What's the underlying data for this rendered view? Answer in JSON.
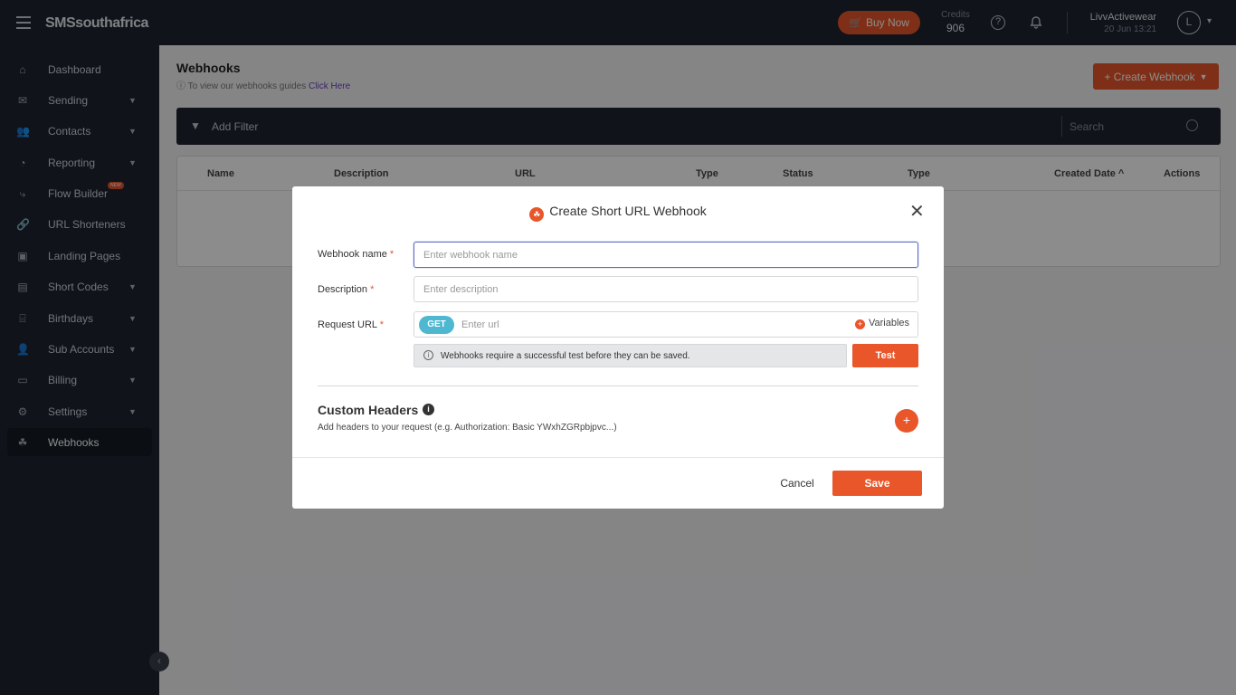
{
  "topbar": {
    "logo": "SMSsouthafrica",
    "buy_now": "Buy Now",
    "credits_label": "Credits",
    "credits_value": "906",
    "user_name": "LivvActivewear",
    "user_date": "20 Jun 13:21",
    "avatar_initial": "L"
  },
  "sidebar": {
    "items": [
      {
        "label": "Dashboard",
        "icon": "home-icon"
      },
      {
        "label": "Sending",
        "icon": "mail-icon"
      },
      {
        "label": "Contacts",
        "icon": "users-icon"
      },
      {
        "label": "Reporting",
        "icon": "chart-icon"
      },
      {
        "label": "Flow Builder",
        "icon": "flow-icon",
        "badge": "NEW"
      },
      {
        "label": "URL Shorteners",
        "icon": "link-icon"
      },
      {
        "label": "Landing Pages",
        "icon": "page-icon"
      },
      {
        "label": "Short Codes",
        "icon": "code-icon"
      },
      {
        "label": "Birthdays",
        "icon": "cake-icon"
      },
      {
        "label": "Sub Accounts",
        "icon": "user-plus-icon"
      },
      {
        "label": "Billing",
        "icon": "card-icon"
      },
      {
        "label": "Settings",
        "icon": "gear-icon"
      },
      {
        "label": "Webhooks",
        "icon": "webhook-icon"
      }
    ]
  },
  "page": {
    "title": "Webhooks",
    "subtitle": "To view our webhooks guides",
    "subtitle_link": "Click Here",
    "create_button": "+ Create Webhook"
  },
  "filterbar": {
    "add_filter": "Add Filter",
    "search_placeholder": "Search"
  },
  "table": {
    "columns": [
      "Name",
      "Description",
      "URL",
      "Type",
      "Status",
      "Type",
      "Created Date",
      "Actions"
    ]
  },
  "modal": {
    "title": "Create Short URL Webhook",
    "name_label": "Webhook name",
    "name_placeholder": "Enter webhook name",
    "description_label": "Description",
    "description_placeholder": "Enter description",
    "url_label": "Request URL",
    "method": "GET",
    "url_placeholder": "Enter url",
    "variables_label": "Variables",
    "notice": "Webhooks require a successful test before they can be saved.",
    "test_button": "Test",
    "custom_headers_title": "Custom Headers",
    "custom_headers_sub": "Add headers to your request (e.g. Authorization: Basic YWxhZGRpbjpvc...)",
    "cancel_button": "Cancel",
    "save_button": "Save"
  },
  "colors": {
    "accent": "#e8562a",
    "navbar": "#1e2430",
    "method_pill": "#4db8d0"
  }
}
